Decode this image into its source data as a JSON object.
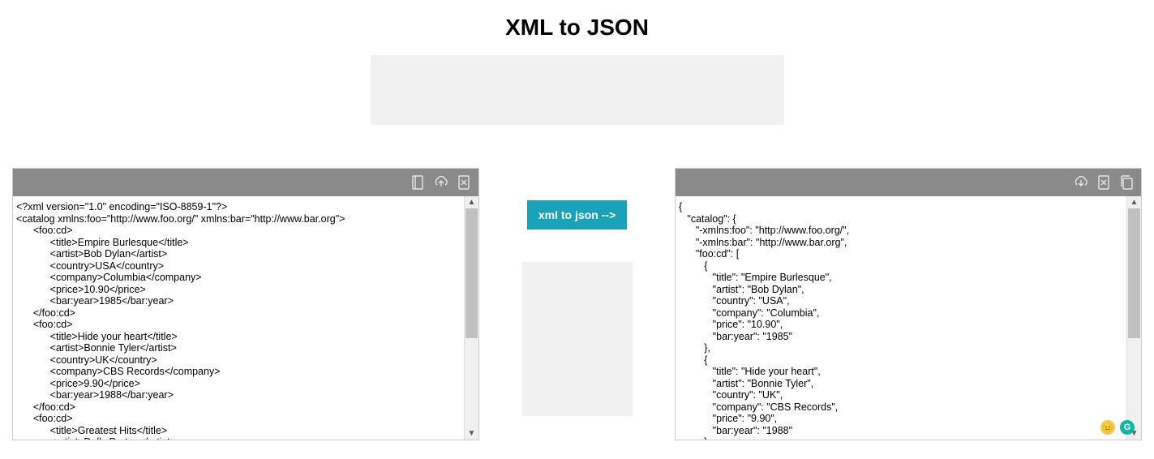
{
  "title": "XML to JSON",
  "convert_button": "xml to json -->",
  "left_toolbar": {
    "icon1": "book-icon",
    "icon2": "upload-icon",
    "icon3": "clear-icon"
  },
  "right_toolbar": {
    "icon1": "download-icon",
    "icon2": "clear-icon",
    "icon3": "copy-icon"
  },
  "xml_content": "<?xml version=\"1.0\" encoding=\"ISO-8859-1\"?>\n<catalog xmlns:foo=\"http://www.foo.org/\" xmlns:bar=\"http://www.bar.org\">\n      <foo:cd>\n            <title>Empire Burlesque</title>\n            <artist>Bob Dylan</artist>\n            <country>USA</country>\n            <company>Columbia</company>\n            <price>10.90</price>\n            <bar:year>1985</bar:year>\n      </foo:cd>\n      <foo:cd>\n            <title>Hide your heart</title>\n            <artist>Bonnie Tyler</artist>\n            <country>UK</country>\n            <company>CBS Records</company>\n            <price>9.90</price>\n            <bar:year>1988</bar:year>\n      </foo:cd>\n      <foo:cd>\n            <title>Greatest Hits</title>\n            <artist>Dolly Parton</artist>",
  "json_content": "{\n   \"catalog\": {\n      \"-xmlns:foo\": \"http://www.foo.org/\",\n      \"-xmlns:bar\": \"http://www.bar.org\",\n      \"foo:cd\": [\n         {\n            \"title\": \"Empire Burlesque\",\n            \"artist\": \"Bob Dylan\",\n            \"country\": \"USA\",\n            \"company\": \"Columbia\",\n            \"price\": \"10.90\",\n            \"bar:year\": \"1985\"\n         },\n         {\n            \"title\": \"Hide your heart\",\n            \"artist\": \"Bonnie Tyler\",\n            \"country\": \"UK\",\n            \"company\": \"CBS Records\",\n            \"price\": \"9.90\",\n            \"bar:year\": \"1988\"\n         }",
  "badges": {
    "face": "😐",
    "g": "G"
  }
}
